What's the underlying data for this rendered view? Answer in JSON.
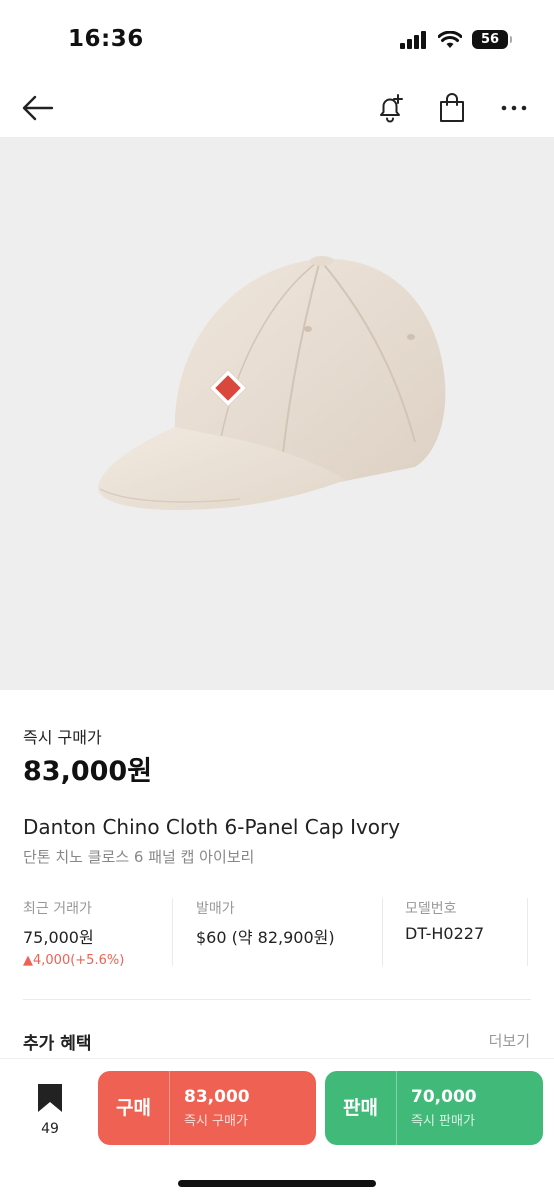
{
  "status": {
    "time": "16:36",
    "battery": "56"
  },
  "nav": {
    "back_icon": "arrow-left-icon",
    "alert_icon": "bell-plus-icon",
    "cart_icon": "shopping-bag-icon",
    "more_icon": "more-horizontal-icon"
  },
  "product": {
    "image_desc": "Ivory six-panel chino cloth cap with red diamond logo patch",
    "price_label": "즉시 구매가",
    "price": "83,000원",
    "name_en": "Danton Chino Cloth 6-Panel Cap Ivory",
    "name_ko": "단톤 치노 클로스 6 패널 캡 아이보리"
  },
  "stats": [
    {
      "label": "최근 거래가",
      "value": "75,000원",
      "change": "▲4,000(+5.6%)"
    },
    {
      "label": "발매가",
      "value": "$60 (약 82,900원)"
    },
    {
      "label": "모델번호",
      "value": "DT-H0227"
    }
  ],
  "benefits": {
    "label": "추가 혜택",
    "more": "더보기"
  },
  "bottom": {
    "wish_count": "49",
    "buy": {
      "title": "구매",
      "price": "83,000",
      "sub": "즉시 구매가"
    },
    "sell": {
      "title": "판매",
      "price": "70,000",
      "sub": "즉시 판매가"
    }
  },
  "colors": {
    "buy": "#ef6253",
    "sell": "#41b979",
    "image_bg": "#eeeeee"
  }
}
